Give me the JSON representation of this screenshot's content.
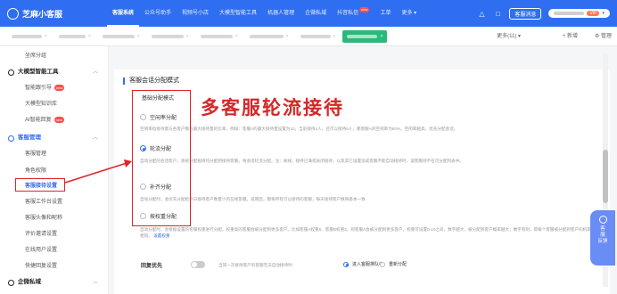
{
  "app": {
    "brand_name": "芝麻小客服"
  },
  "topnav": {
    "items": [
      {
        "label": "客服系统",
        "active": true
      },
      {
        "label": "公众号助手"
      },
      {
        "label": "视频号小店"
      },
      {
        "label": "大模型智能工具"
      },
      {
        "label": "机器人管理"
      },
      {
        "label": "企微私域"
      },
      {
        "label": "抖音私信",
        "badge": "new"
      },
      {
        "label": "工单"
      },
      {
        "label": "更多"
      }
    ],
    "message_button": "客服消息",
    "user_tag": "VIP"
  },
  "tabs": {
    "items": [
      {
        "label": "",
        "active": false
      },
      {
        "label": "",
        "active": false
      },
      {
        "label": "",
        "active": false
      },
      {
        "label": "",
        "active": false
      },
      {
        "label": "",
        "active": false
      },
      {
        "label": "",
        "active": false
      },
      {
        "label": "",
        "active": false
      },
      {
        "label": "",
        "active": true
      }
    ],
    "more_label": "更多(11)",
    "add_label": "+ 新增",
    "settings_label": "管理"
  },
  "sidebar": {
    "top_item": "坐席分组",
    "group_ai": "大模型智能工具",
    "ai_items": [
      {
        "label": "智能跟引导",
        "badge": "new"
      },
      {
        "label": "大模型知识库"
      },
      {
        "label": "AI智能回复",
        "badge": "new"
      }
    ],
    "group_service": "客服管理",
    "service_items": [
      {
        "label": "客服管理"
      },
      {
        "label": "角色权限"
      },
      {
        "label": "客服接待设置",
        "selected": true
      },
      {
        "label": "客服工作台设置"
      },
      {
        "label": "客服头像和昵称"
      },
      {
        "label": "评价邀请设置"
      },
      {
        "label": "在线用户设置"
      },
      {
        "label": "快捷回复设置"
      }
    ],
    "group_wecom": "企微私域"
  },
  "main": {
    "section_title": "客服会话分配模式",
    "sub_label": "基础分配模式",
    "options": [
      {
        "label": "空闲率分配",
        "checked": false,
        "desc": "空闲率指接待量与各客户数占最大接待量的比率，例如：客服A的最大接待量设置为10，当前接待4人，还可以接待6人，那客服A的空闲率为60%。空闲率越高，优先分配会话。"
      },
      {
        "label": "轮流分配",
        "checked": true,
        "desc": "自动分配的会话客户，系统分配规则均分配到接待客服，将会话轮流分配。注：离线、接待已满或关闭接待，以及其它设置造成客服不能自动接待时，该客服则不在可分配列表中。"
      },
      {
        "label": "补齐分配",
        "checked": false,
        "desc": "自动分配时，会优先分配给今日接待客户数量少的在线客服。说明后，都将所有可以接待的客服，每天接待客户数将基本一致"
      },
      {
        "label": "按权重分配",
        "checked": false,
        "desc": "自动分配时，会根据设置的客服权重进行分配，权重高的客服会被分配到更多客户。比如客服A权重5、客服B权重3、则客服A会被分配到更多客户，权重可设置0-10之间，数字越大，被分配到客户概率越大；数字有则，即每个客服被分配到客户的机率相同。",
        "link": "设置权重"
      }
    ],
    "overlay_text": "多客服轮流接待",
    "toggle_label": "回复优先",
    "toggle_desc": "当同一次接待客户的客服无法自动接待时：",
    "toggle_opt1": "进入客服排队中",
    "toggle_opt2": "重新分配"
  },
  "float_service": {
    "line1": "客",
    "line2": "服",
    "line3": "反馈"
  },
  "colors": {
    "brand_blue": "#2f6ef0",
    "highlight_red": "#e0232b",
    "active_tab_green": "#2db77b"
  }
}
